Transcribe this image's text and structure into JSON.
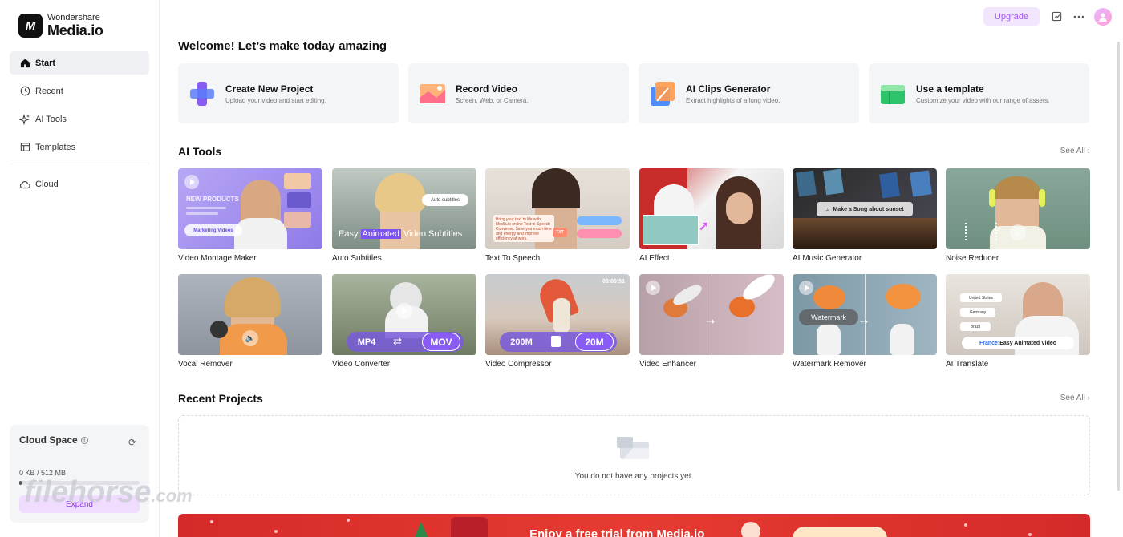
{
  "brand": {
    "top": "Wondershare",
    "bottom": "Media.io",
    "mark": "M"
  },
  "sidebar": {
    "items": [
      {
        "label": "Start",
        "icon": "home-icon"
      },
      {
        "label": "Recent",
        "icon": "clock-icon"
      },
      {
        "label": "AI Tools",
        "icon": "sparkle-icon"
      },
      {
        "label": "Templates",
        "icon": "template-icon"
      },
      {
        "label": "Cloud",
        "icon": "cloud-icon"
      }
    ]
  },
  "cloud": {
    "title": "Cloud Space",
    "usage": "0 KB / 512 MB",
    "usage_fraction": 0.0,
    "expand_label": "Expand"
  },
  "header": {
    "upgrade_label": "Upgrade"
  },
  "welcome": "Welcome! Let’s make today amazing",
  "quick_actions": [
    {
      "title": "Create New Project",
      "subtitle": "Upload your video and start editing."
    },
    {
      "title": "Record Video",
      "subtitle": "Screen, Web, or Camera."
    },
    {
      "title": "AI Clips Generator",
      "subtitle": "Extract highlights of a long video."
    },
    {
      "title": "Use a template",
      "subtitle": "Customize your video with our range of assets."
    }
  ],
  "ai_tools": {
    "title": "AI Tools",
    "see_all": "See All",
    "tools": [
      {
        "label": "Video Montage Maker"
      },
      {
        "label": "Auto Subtitles"
      },
      {
        "label": "Text To Speech"
      },
      {
        "label": "AI Effect"
      },
      {
        "label": "AI Music Generator"
      },
      {
        "label": "Noise Reducer"
      },
      {
        "label": "Vocal Remover"
      },
      {
        "label": "Video Converter"
      },
      {
        "label": "Video Compressor"
      },
      {
        "label": "Video Enhancer"
      },
      {
        "label": "Watermark Remover"
      },
      {
        "label": "AI Translate"
      }
    ]
  },
  "thumb_text": {
    "montage_title": "NEW PRODUCTS",
    "montage_chip": "Marketing Videos",
    "subtitles_chip": "Auto subtitles",
    "subtitles_a": "Easy ",
    "subtitles_b": "Animated",
    "subtitles_c": " Video Subtitles",
    "tts_text": "Bring your text to life with Media.io online Text to Speech Converter. Save you much time and energy and improve efficiency at work.",
    "tts_badge": "TXT",
    "music_chip": "Make a Song about sunset",
    "conv_from": "MP4",
    "conv_to": "MOV",
    "comp_time": "00:00:51",
    "comp_from": "200M",
    "comp_to": "20M",
    "wm_text": "Watermark",
    "tr_lang1": "United States",
    "tr_lang2": "Germany",
    "tr_lang3": "Brazil",
    "tr_country": "France:",
    "tr_caption": " Easy Animated Video"
  },
  "recent": {
    "title": "Recent Projects",
    "see_all": "See All",
    "empty_text": "You do not have any projects yet."
  },
  "banner": {
    "text": "Enjoy a free trial from Media.io"
  },
  "watermark": {
    "text": "filehorse",
    "suffix": ".com"
  }
}
